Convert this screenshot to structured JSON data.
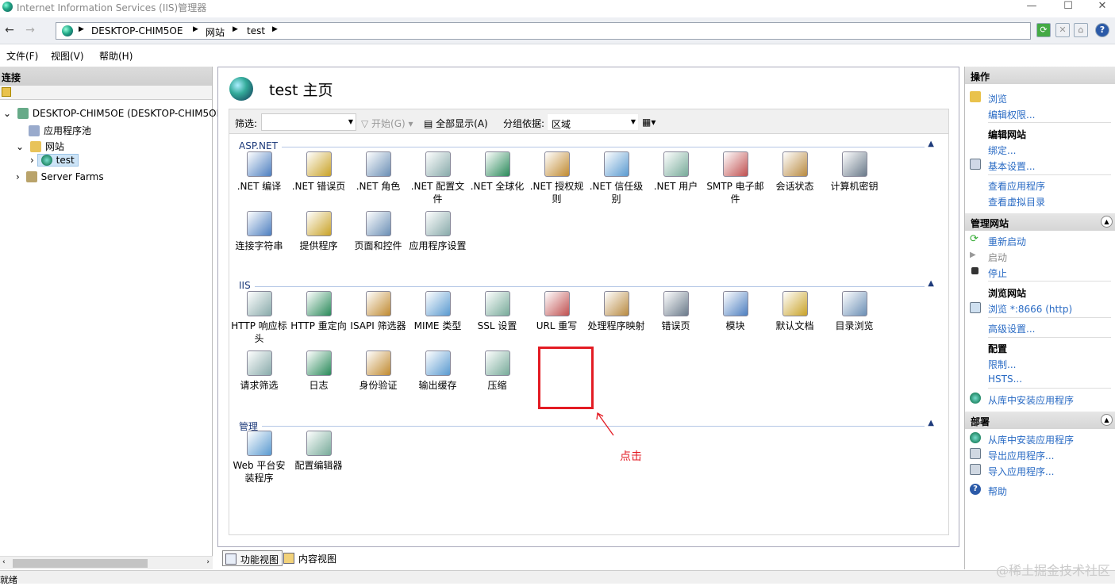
{
  "window": {
    "title": "Internet Information Services (IIS)管理器",
    "min": "—",
    "max": "☐",
    "close": "✕"
  },
  "address": {
    "crumbs": [
      "DESKTOP-CHIM5OE",
      "网站",
      "test"
    ]
  },
  "menu": [
    "文件(F)",
    "视图(V)",
    "帮助(H)"
  ],
  "left_panel": {
    "header": "连接",
    "tree": [
      {
        "label": "DESKTOP-CHIM5OE (DESKTOP-CHIM5OE",
        "expander": "⌄"
      },
      {
        "label": "应用程序池",
        "expander": ""
      },
      {
        "label": "网站",
        "expander": "⌄"
      },
      {
        "label": "test",
        "expander": "›"
      },
      {
        "label": "Server Farms",
        "expander": "›"
      }
    ]
  },
  "center": {
    "title": "test 主页",
    "filter_label": "筛选:",
    "start_label": "开始(G)",
    "show_all_label": "全部显示(A)",
    "group_by_label": "分组依据:",
    "group_by_value": "区域",
    "groups": [
      {
        "name": "ASP.NET",
        "items": [
          ".NET 编译",
          ".NET 错误页",
          ".NET 角色",
          ".NET 配置文件",
          ".NET 全球化",
          ".NET 授权规则",
          ".NET 信任级别",
          ".NET 用户",
          "SMTP 电子邮件",
          "会话状态",
          "计算机密钥",
          "连接字符串",
          "提供程序",
          "页面和控件",
          "应用程序设置"
        ]
      },
      {
        "name": "IIS",
        "items": [
          "HTTP 响应标头",
          "HTTP 重定向",
          "ISAPI 筛选器",
          "MIME 类型",
          "SSL 设置",
          "URL 重写",
          "处理程序映射",
          "错误页",
          "模块",
          "默认文档",
          "目录浏览",
          "请求筛选",
          "日志",
          "身份验证",
          "输出缓存",
          "压缩"
        ]
      },
      {
        "name": "管理",
        "items": [
          "Web 平台安装程序",
          "配置编辑器"
        ]
      }
    ],
    "annotation": "点击",
    "view_tabs": [
      "功能视图",
      "内容视图"
    ]
  },
  "right_panel": {
    "header": "操作",
    "browse": "浏览",
    "edit_perms": "编辑权限...",
    "edit_site": "编辑网站",
    "bindings": "绑定...",
    "basic_settings": "基本设置...",
    "view_apps": "查看应用程序",
    "view_vdirs": "查看虚拟目录",
    "manage_site": "管理网站",
    "restart": "重新启动",
    "start": "启动",
    "stop": "停止",
    "browse_site": "浏览网站",
    "browse_port": "浏览 *:8666 (http)",
    "advanced": "高级设置...",
    "config": "配置",
    "limits": "限制...",
    "hsts": "HSTS...",
    "install_gallery": "从库中安装应用程序",
    "deploy": "部署",
    "install_gallery2": "从库中安装应用程序",
    "export_app": "导出应用程序...",
    "import_app": "导入应用程序...",
    "help": "帮助"
  },
  "status": "就绪",
  "watermark": "@稀土掘金技术社区"
}
